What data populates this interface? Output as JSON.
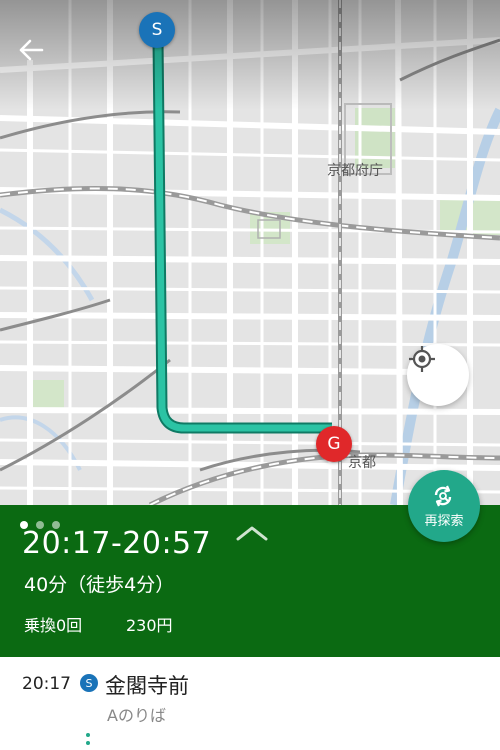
{
  "nav": {
    "back_icon": "arrow-left-icon"
  },
  "map": {
    "labels": {
      "prefecture_office": "京都府庁",
      "station": "京都"
    },
    "start_pin": "S",
    "goal_pin": "G",
    "route_color": "#2bb39a",
    "locate_icon": "crosshair-icon"
  },
  "research_button": {
    "label": "再探索",
    "icon": "refresh-search-icon"
  },
  "summary": {
    "pager_count": 3,
    "active_index": 0,
    "time_range": "20:17-20:57",
    "duration": "40分（徒歩4分）",
    "transfers": "乗換0回",
    "fare": "230円",
    "background_color": "#0b6a12"
  },
  "detail": {
    "departure_time": "20:17",
    "station_badge": "S",
    "station_name": "金閣寺前",
    "platform": "Aのりば"
  }
}
